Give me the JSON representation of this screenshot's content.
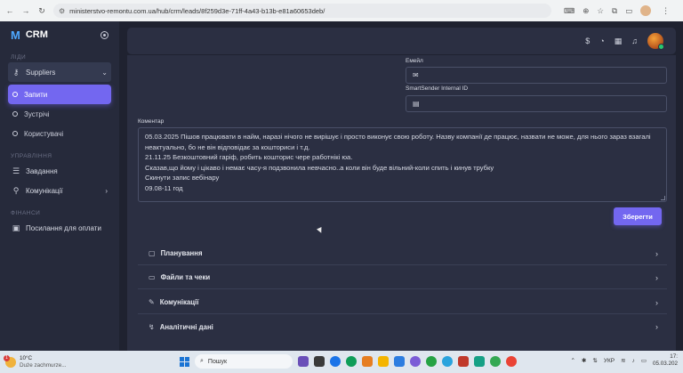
{
  "browser": {
    "url": "ministerstvo-remontu.com.ua/hub/crm/leads/8f259d3e-71ff-4a43-b13b-e81a60653deb/"
  },
  "sidebar": {
    "brand": "CRM",
    "sections": {
      "leads": "ЛІДИ",
      "management": "УПРАВЛІННЯ",
      "finance": "ФІНАНСИ"
    },
    "group_label": "Suppliers",
    "sub_items": [
      {
        "label": "Запити",
        "active": true
      },
      {
        "label": "Зустрічі",
        "active": false
      },
      {
        "label": "Користувачі",
        "active": false
      }
    ],
    "management_items": [
      "Завдання",
      "Комунікації"
    ],
    "finance_items": [
      "Посилання для оплати"
    ]
  },
  "form": {
    "email_label": "Емейл",
    "smartsender_label": "SmartSender Internal ID",
    "comment_label": "Коментар",
    "comment_lines": [
      "05.03.2025 Пішов працювати в найм, наразі нічого не вирішує і просто виконує свою роботу. Назву компанії де працює, назвати не може, для нього зараз взагалі",
      "неактуально, бо не він відповідає за кошториси і т.д.",
      "21.11.25 Безкоштовний гаріф, робить кошторис чере работнікі юа.",
      "Сказав,що йому і цікаво і немає часу-я подзвонила невчасно..а коли він буде вільний-коли спить і кинув трубку",
      "Скинути запис вебінару",
      "09.08-11 год"
    ],
    "save_label": "Зберегти"
  },
  "accordions": [
    {
      "label": "Планування",
      "icon": "calendar-icon"
    },
    {
      "label": "Файли та чеки",
      "icon": "file-icon"
    },
    {
      "label": "Комунікації",
      "icon": "chat-icon"
    },
    {
      "label": "Аналітичні дані",
      "icon": "chart-icon"
    }
  ],
  "taskbar": {
    "temperature": "10°C",
    "weather_text": "Duże zachmurze...",
    "weather_badge": "1",
    "search_placeholder": "Пошук",
    "language": "УКР",
    "time": "17:",
    "date": "05.03.202"
  },
  "colors": {
    "accent": "#7367f0",
    "sidebar_bg": "#262a3b",
    "card_bg": "#2b2f42",
    "page_bg": "#1f2230"
  }
}
